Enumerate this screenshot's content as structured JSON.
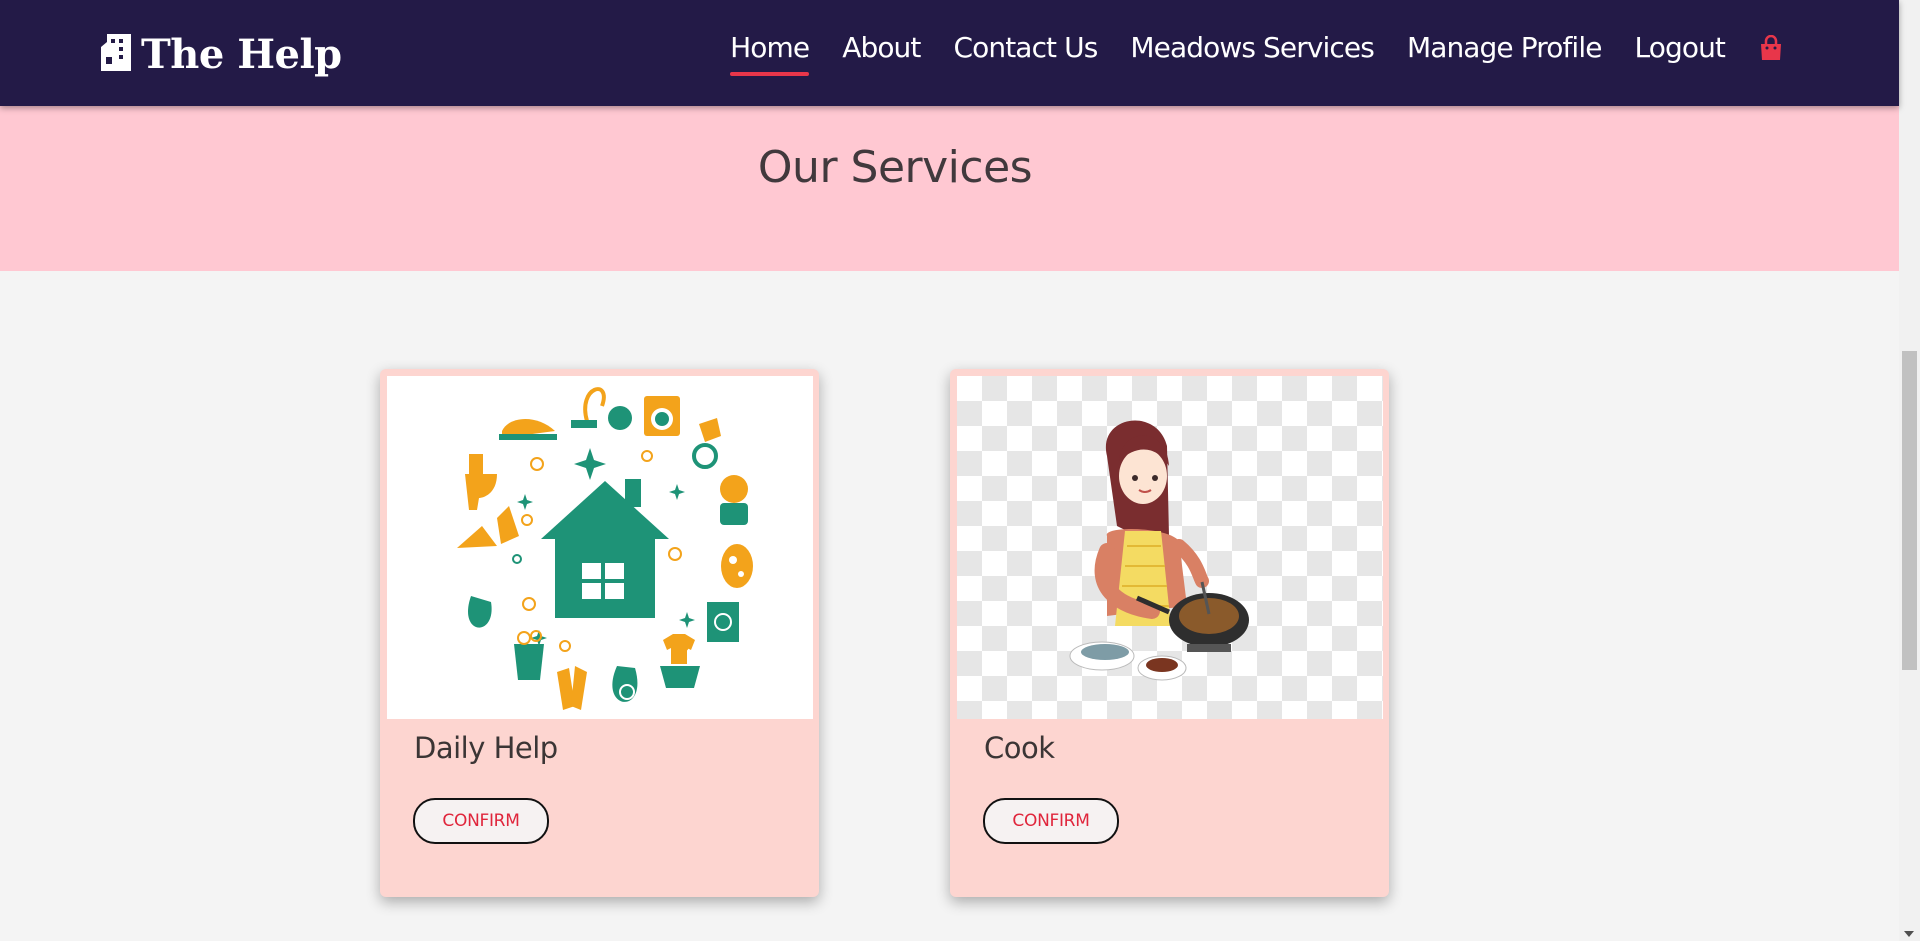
{
  "navbar": {
    "brand": "The Help",
    "brand_icon": "building-icon",
    "links": [
      {
        "label": "Home",
        "active": true
      },
      {
        "label": "About",
        "active": false
      },
      {
        "label": "Contact Us",
        "active": false
      },
      {
        "label": "Meadows Services",
        "active": false
      },
      {
        "label": "Manage Profile",
        "active": false
      },
      {
        "label": "Logout",
        "active": false
      }
    ],
    "cart_icon": "shopping-bag-icon"
  },
  "banner": {
    "title": "Our Services"
  },
  "services": [
    {
      "title": "Daily Help",
      "button": "CONFIRM",
      "image": "house-cleaning-illustration"
    },
    {
      "title": "Cook",
      "button": "CONFIRM",
      "image": "woman-cooking-illustration"
    }
  ],
  "colors": {
    "navbar_bg": "#231a47",
    "accent": "#e8364a",
    "banner_bg": "#ffc8d2",
    "card_bg": "#fdd5d0",
    "page_bg": "#f4f4f4",
    "illustration_green": "#1e9377",
    "illustration_orange": "#f3a31b"
  }
}
